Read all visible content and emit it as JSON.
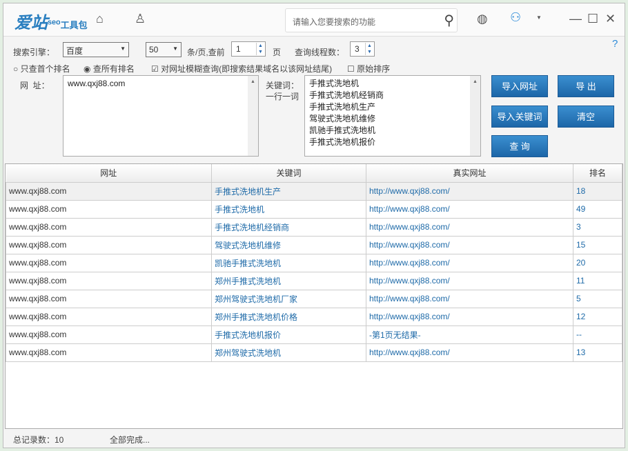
{
  "header": {
    "logo": "爱站",
    "logo_sup": "seo",
    "logo_sub": "工具包",
    "search_placeholder": "请输入您要搜索的功能"
  },
  "form": {
    "engine_label": "搜索引擎：",
    "engine": "百度",
    "per_page": "50",
    "per_page_label": "条/页,查前",
    "pages": "1",
    "pages_label": "页",
    "threads_label": "查询线程数：",
    "threads": "3",
    "radio_first": "只查首个排名",
    "radio_all": "查所有排名",
    "fuzzy": "对网址模糊查询(即搜索结果域名以该网址结尾)",
    "original": "原始排序",
    "url_label": "网  址：",
    "url_value": "www.qxj88.com",
    "kw_label": "关键词：",
    "kw_label2": "一行一词",
    "keywords": [
      "手推式洗地机",
      "手推式洗地机经销商",
      "手推式洗地机生产",
      "驾驶式洗地机维修",
      "凯驰手推式洗地机",
      "手推式洗地机报价"
    ]
  },
  "buttons": {
    "import_url": "导入网址",
    "export": "导 出",
    "import_kw": "导入关键词",
    "clear": "清空",
    "query": "查 询"
  },
  "table": {
    "headers": [
      "网址",
      "关键词",
      "真实网址",
      "排名"
    ],
    "rows": [
      [
        "www.qxj88.com",
        "手推式洗地机生产",
        "http://www.qxj88.com/",
        "18"
      ],
      [
        "www.qxj88.com",
        "手推式洗地机",
        "http://www.qxj88.com/",
        "49"
      ],
      [
        "www.qxj88.com",
        "手推式洗地机经销商",
        "http://www.qxj88.com/",
        "3"
      ],
      [
        "www.qxj88.com",
        "驾驶式洗地机维修",
        "http://www.qxj88.com/",
        "15"
      ],
      [
        "www.qxj88.com",
        "凯驰手推式洗地机",
        "http://www.qxj88.com/",
        "20"
      ],
      [
        "www.qxj88.com",
        "郑州手推式洗地机",
        "http://www.qxj88.com/",
        "11"
      ],
      [
        "www.qxj88.com",
        "郑州驾驶式洗地机厂家",
        "http://www.qxj88.com/",
        "5"
      ],
      [
        "www.qxj88.com",
        "郑州手推式洗地机价格",
        "http://www.qxj88.com/",
        "12"
      ],
      [
        "www.qxj88.com",
        "手推式洗地机报价",
        "-第1页无结果-",
        "--"
      ],
      [
        "www.qxj88.com",
        "郑州驾驶式洗地机",
        "http://www.qxj88.com/",
        "13"
      ]
    ]
  },
  "status": {
    "total": "总记录数：10",
    "done": "全部完成..."
  }
}
